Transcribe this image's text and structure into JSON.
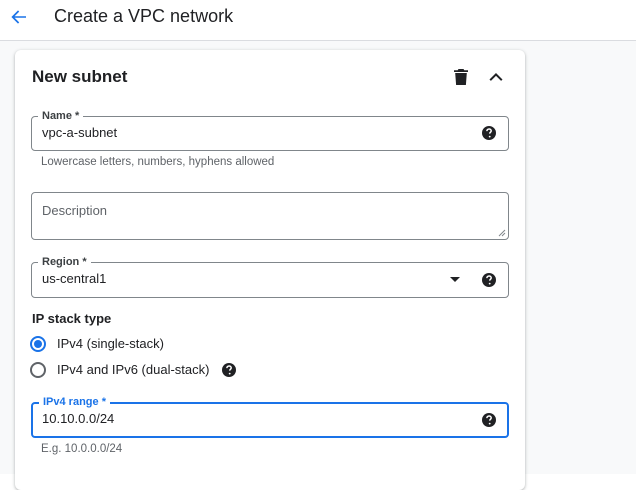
{
  "header": {
    "title": "Create a VPC network"
  },
  "subnet": {
    "title": "New subnet",
    "name": {
      "label": "Name *",
      "value": "vpc-a-subnet",
      "hint": "Lowercase letters, numbers, hyphens allowed"
    },
    "description": {
      "placeholder": "Description"
    },
    "region": {
      "label": "Region *",
      "value": "us-central1"
    },
    "ip_stack": {
      "label": "IP stack type",
      "options": [
        "IPv4 (single-stack)",
        "IPv4 and IPv6 (dual-stack)"
      ],
      "selected": "IPv4 (single-stack)"
    },
    "ipv4_range": {
      "label": "IPv4 range *",
      "value": "10.10.0.0/24",
      "hint": "E.g. 10.0.0.0/24"
    }
  },
  "colors": {
    "accent": "#1a73e8",
    "text": "#202124",
    "muted": "#5f6368",
    "border": "#80868b"
  },
  "icons": [
    "arrow-back-icon",
    "trash-icon",
    "chevron-up-icon",
    "help-icon",
    "dropdown-arrow-icon"
  ]
}
